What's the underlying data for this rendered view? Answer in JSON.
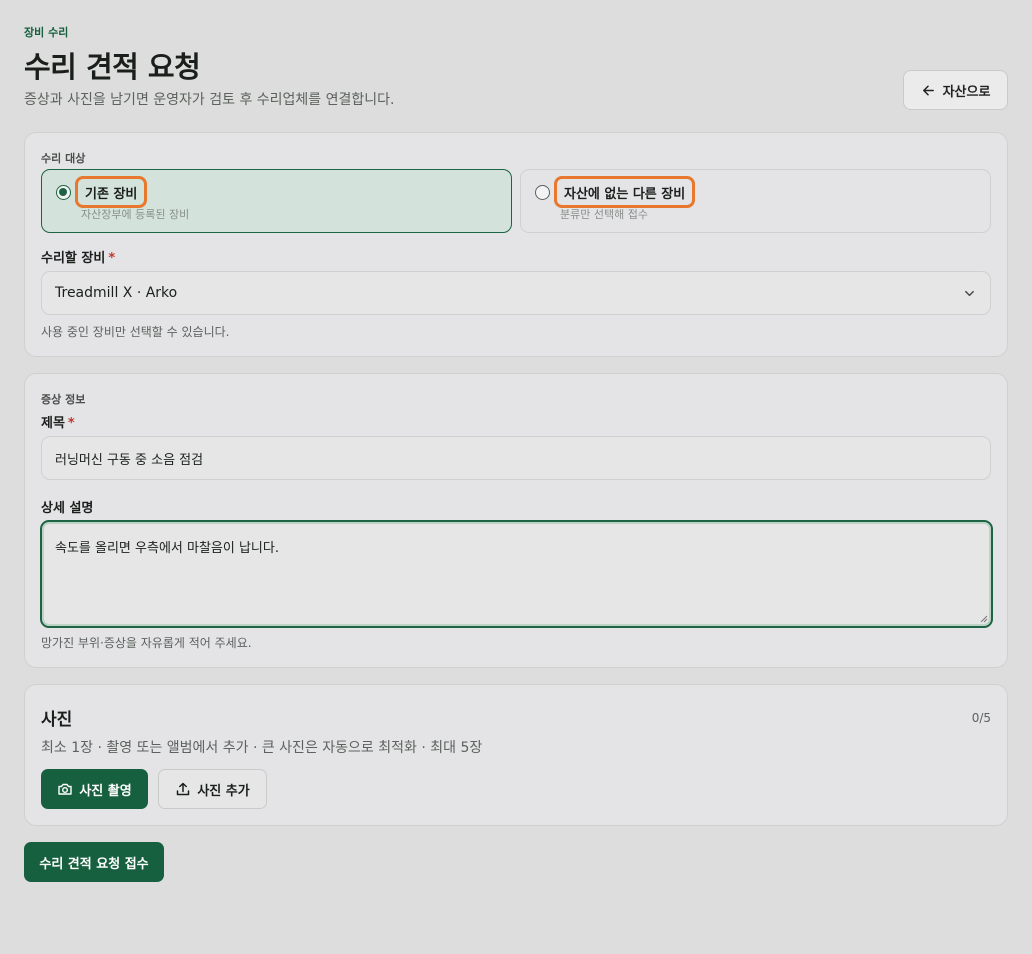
{
  "header": {
    "eyebrow": "장비 수리",
    "title": "수리 견적 요청",
    "subtitle": "증상과 사진을 남기면 운영자가 검토 후 수리업체를 연결합니다.",
    "back_label": "자산으로"
  },
  "target": {
    "section_label": "수리 대상",
    "options": [
      {
        "title": "기존 장비",
        "desc": "자산장부에 등록된 장비",
        "selected": true
      },
      {
        "title": "자산에 없는 다른 장비",
        "desc": "분류만 선택해 접수",
        "selected": false
      }
    ],
    "equipment_label": "수리할 장비",
    "required_mark": "*",
    "equipment_value": "Treadmill X · Arko",
    "equipment_hint": "사용 중인 장비만 선택할 수 있습니다."
  },
  "symptom": {
    "section_label": "증상 정보",
    "title_label": "제목",
    "required_mark": "*",
    "title_value": "러닝머신 구동 중 소음 점검",
    "detail_label": "상세 설명",
    "detail_value": "속도를 올리면 우측에서 마찰음이 납니다.",
    "detail_hint": "망가진 부위·증상을 자유롭게 적어 주세요."
  },
  "photos": {
    "title": "사진",
    "count": "0/5",
    "desc": "최소 1장 · 촬영 또는 앨범에서 추가 · 큰 사진은 자동으로 최적화 · 최대 5장",
    "capture_label": "사진 촬영",
    "add_label": "사진 추가"
  },
  "submit_label": "수리 견적 요청 접수",
  "colors": {
    "accent": "#17603f",
    "highlight": "#e7782e",
    "background": "#dcdddc"
  }
}
